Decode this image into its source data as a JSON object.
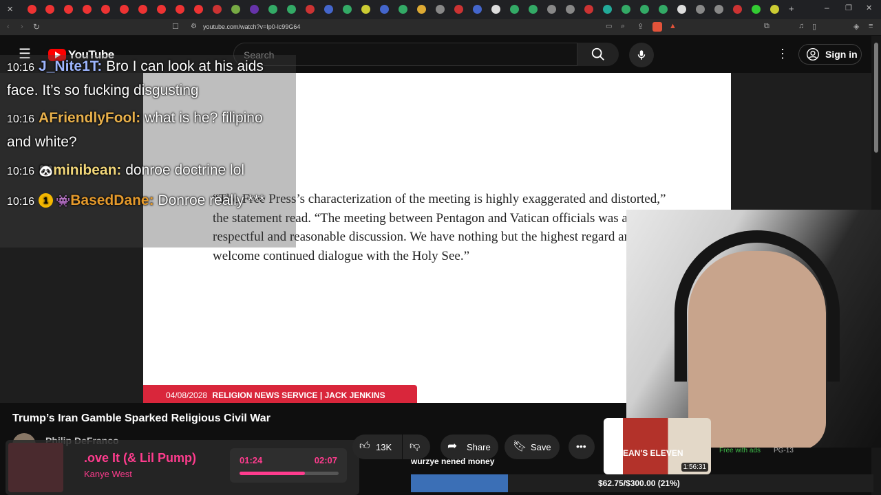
{
  "browser": {
    "url": "youtube.com/watch?v=Ip0-lc99G64",
    "colors": {
      "tabstrip": "#202124",
      "toolbar": "#2b2b2b"
    }
  },
  "youtube": {
    "logo_label": "YouTube",
    "search_placeholder": "Search",
    "signin_label": "Sign in"
  },
  "video": {
    "quote": "“The Free Press’s characterization of the meeting is highly exaggerated and distorted,” the statement read. “The meeting between Pentagon and Vatican officials was a respectful and reasonable discussion. We have nothing but the highest regard and welcome continued dialogue with the Holy See.”",
    "banner_date": "04/08/2028",
    "banner_source": "RELIGION NEWS SERVICE | JACK JENKINS",
    "title": "Trump’s Iran Gamble Sparked Religious Civil War",
    "channel": "Philip DeFranco",
    "likes": "13K",
    "share_label": "Share",
    "save_label": "Save",
    "side_duration": "1:56:31",
    "side_badge_1": "Free with ads",
    "side_badge_2": "PG-13",
    "side_thumb_text": "OCEAN'S ELEVEN"
  },
  "chat": [
    {
      "time": "10:16",
      "user": "J_Nite1T:",
      "user_color": "#9eb6ff",
      "message": "Bro I can look at his aids face. It’s so fucking disgusting"
    },
    {
      "time": "10:16",
      "user": "AFriendlyFool:",
      "user_color": "#e8b04b",
      "message": "what is he? filipino and white?"
    },
    {
      "time": "10:16",
      "user": "minibean:",
      "user_color": "#f2d77a",
      "message": "donroe doctrine lol"
    },
    {
      "time": "10:16",
      "user": "BasedDane:",
      "user_color": "#e59a2c",
      "message": "Donroe really ***",
      "badge": "1"
    }
  ],
  "now_playing": {
    "title": ".ove It (& Lil Pump)",
    "artist": "Kanye West",
    "elapsed": "01:24",
    "total": "02:07",
    "progress": 0.66
  },
  "stream_overlay": {
    "donation_text": "wurzye nened money",
    "goal_text": "$62.75/$300.00 (21%)",
    "goal_progress": 0.21
  }
}
